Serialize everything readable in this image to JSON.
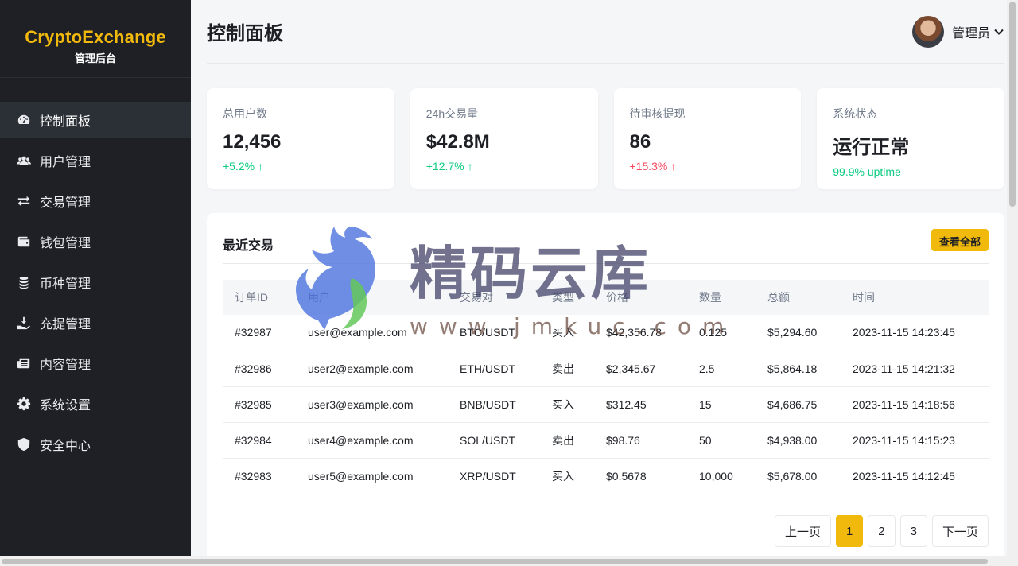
{
  "brand": {
    "name": "CryptoExchange",
    "subtitle": "管理后台"
  },
  "sidebar": {
    "items": [
      {
        "label": "控制面板",
        "icon": "dashboard-icon",
        "active": true
      },
      {
        "label": "用户管理",
        "icon": "users-icon"
      },
      {
        "label": "交易管理",
        "icon": "exchange-icon"
      },
      {
        "label": "钱包管理",
        "icon": "wallet-icon"
      },
      {
        "label": "币种管理",
        "icon": "coins-icon"
      },
      {
        "label": "充提管理",
        "icon": "deposit-icon"
      },
      {
        "label": "内容管理",
        "icon": "newspaper-icon"
      },
      {
        "label": "系统设置",
        "icon": "gear-icon"
      },
      {
        "label": "安全中心",
        "icon": "shield-icon"
      }
    ]
  },
  "header": {
    "title": "控制面板",
    "user_name": "管理员"
  },
  "stats": [
    {
      "label": "总用户数",
      "value": "12,456",
      "change": "+5.2%",
      "trend": "up"
    },
    {
      "label": "24h交易量",
      "value": "$42.8M",
      "change": "+12.7%",
      "trend": "up"
    },
    {
      "label": "待审核提现",
      "value": "86",
      "change": "+15.3%",
      "trend": "down"
    },
    {
      "label": "系统状态",
      "value": "运行正常",
      "change": "99.9% uptime",
      "trend": "up"
    }
  ],
  "recent": {
    "title": "最近交易",
    "view_all": "查看全部",
    "columns": [
      "订单ID",
      "用户",
      "交易对",
      "类型",
      "价格",
      "数量",
      "总额",
      "时间"
    ],
    "rows": [
      [
        "#32987",
        "user@example.com",
        "BTC/USDT",
        "买入",
        "$42,356.78",
        "0.125",
        "$5,294.60",
        "2023-11-15 14:23:45"
      ],
      [
        "#32986",
        "user2@example.com",
        "ETH/USDT",
        "卖出",
        "$2,345.67",
        "2.5",
        "$5,864.18",
        "2023-11-15 14:21:32"
      ],
      [
        "#32985",
        "user3@example.com",
        "BNB/USDT",
        "买入",
        "$312.45",
        "15",
        "$4,686.75",
        "2023-11-15 14:18:56"
      ],
      [
        "#32984",
        "user4@example.com",
        "SOL/USDT",
        "卖出",
        "$98.76",
        "50",
        "$4,938.00",
        "2023-11-15 14:15:23"
      ],
      [
        "#32983",
        "user5@example.com",
        "XRP/USDT",
        "买入",
        "$0.5678",
        "10,000",
        "$5,678.00",
        "2023-11-15 14:12:45"
      ]
    ]
  },
  "pagination": {
    "prev": "上一页",
    "pages": [
      "1",
      "2",
      "3"
    ],
    "current": "1",
    "next": "下一页"
  },
  "watermark": {
    "text": "精码云库",
    "url": "www.jmkuc.com"
  },
  "colors": {
    "accent": "#f0b90b",
    "sidebar_bg": "#1e2026",
    "up": "#0ecb81",
    "down": "#f6465d"
  }
}
